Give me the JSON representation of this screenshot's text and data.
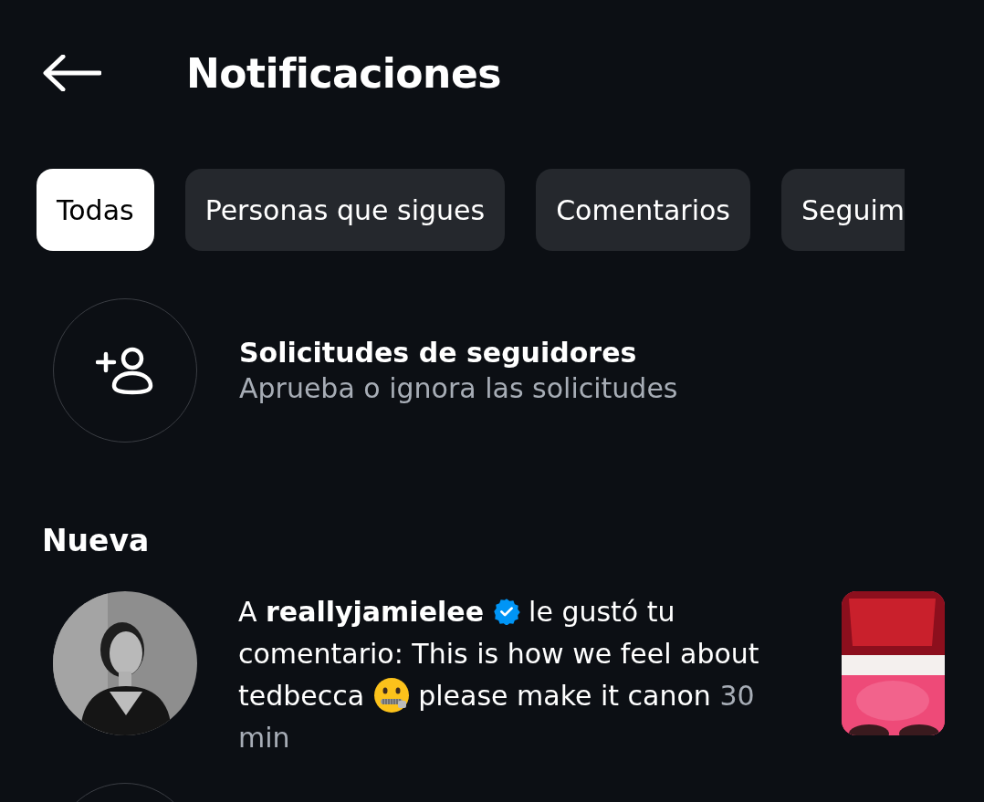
{
  "header": {
    "title": "Notificaciones"
  },
  "tabs": [
    {
      "label": "Todas",
      "selected": true
    },
    {
      "label": "Personas que sigues",
      "selected": false
    },
    {
      "label": "Comentarios",
      "selected": false
    },
    {
      "label": "Seguim",
      "selected": false
    }
  ],
  "follow_requests": {
    "title": "Solicitudes de seguidores",
    "subtitle": "Aprueba o ignora las solicitudes"
  },
  "sections": [
    {
      "heading": "Nueva",
      "notifications": [
        {
          "parts": [
            {
              "kind": "text",
              "text": "A"
            },
            {
              "kind": "user",
              "text": "reallyjamielee"
            },
            {
              "kind": "verified"
            },
            {
              "kind": "text",
              "text": "le gustó tu comentario: This is how we feel about tedbecca"
            },
            {
              "kind": "emoji"
            },
            {
              "kind": "text",
              "text": "please make it canon"
            }
          ],
          "time": "30 min"
        }
      ]
    }
  ]
}
